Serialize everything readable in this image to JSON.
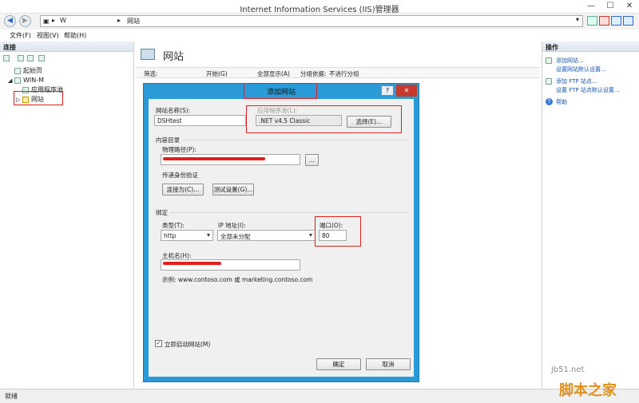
{
  "window": {
    "title": "Internet Information Services (IIS)管理器"
  },
  "address": {
    "segments": [
      "W",
      "网站"
    ]
  },
  "menu": {
    "items": [
      "文件(F)",
      "视图(V)",
      "帮助(H)"
    ]
  },
  "connections": {
    "header": "连接",
    "tree": [
      {
        "label": "起始页"
      },
      {
        "label": "WIN-M"
      },
      {
        "label": "应用程序池"
      },
      {
        "label": "网站"
      }
    ]
  },
  "main": {
    "title": "网站",
    "filter": {
      "label": "筛选:",
      "start": "开始(G)",
      "show_all": "全部显示(A)",
      "group_label": "分组依据:",
      "group_value": "不进行分组"
    }
  },
  "actions": {
    "header": "操作",
    "items": [
      "添加网站...",
      "设置网站默认设置...",
      "添加 FTP 站点...",
      "设置 FTP 站点默认设置...",
      "帮助"
    ]
  },
  "status": {
    "text": "就绪"
  },
  "dialog": {
    "title": "添加网站",
    "site_name_label": "网站名称(S):",
    "site_name_value": "DSHtest",
    "app_pool_label": "应用程序池(L):",
    "app_pool_value": ".NET v4.5 Classic",
    "select_button": "选择(E)...",
    "content_dir_label": "内容目录",
    "physical_path_label": "物理路径(P):",
    "browse_button": "...",
    "passthrough_label": "传递身份验证",
    "connect_as_button": "连接为(C)...",
    "test_settings_button": "测试设置(G)...",
    "binding_label": "绑定",
    "type_label": "类型(T):",
    "type_value": "http",
    "ip_label": "IP 地址(I):",
    "ip_value": "全部未分配",
    "port_label": "端口(O):",
    "port_value": "80",
    "host_label": "主机名(H):",
    "example_text": "示例: www.contoso.com 或 marketing.contoso.com",
    "start_immediately_label": "立即启动网站(M)",
    "ok_button": "确定",
    "cancel_button": "取消",
    "help_button": "?",
    "close_button": "✕"
  },
  "watermark": {
    "site": "jb51.net",
    "brand": "脚本之家"
  },
  "colors": {
    "accent": "#2b9bd8",
    "annotation": "#e02020"
  }
}
